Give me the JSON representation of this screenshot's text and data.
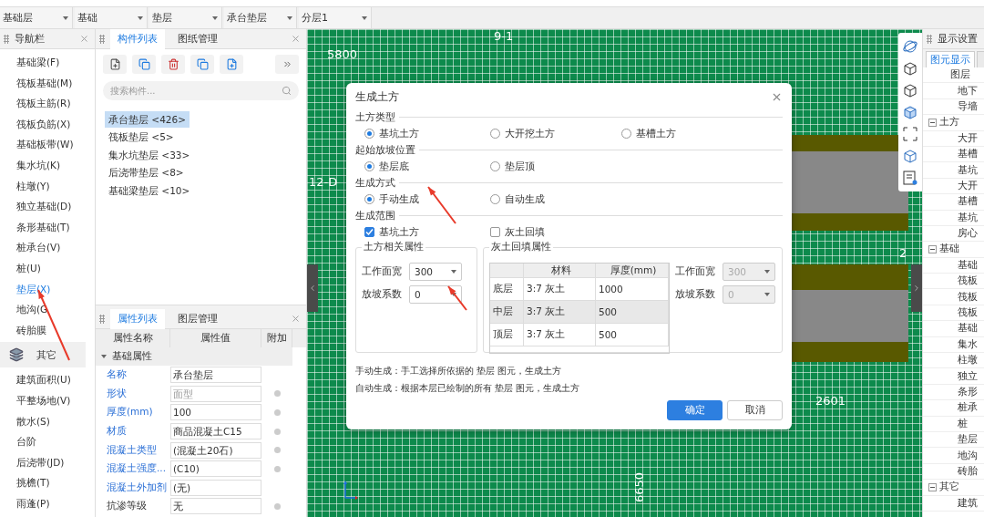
{
  "level_bar": [
    {
      "label": "基础层"
    },
    {
      "label": "基础"
    },
    {
      "label": "垫层"
    },
    {
      "label": "承台垫层"
    },
    {
      "label": "分层1"
    }
  ],
  "nav": {
    "title": "导航栏",
    "items": [
      {
        "label": "基础梁(F)",
        "selected": false
      },
      {
        "label": "筏板基础(M)",
        "selected": false
      },
      {
        "label": "筏板主筋(R)",
        "selected": false
      },
      {
        "label": "筏板负筋(X)",
        "selected": false
      },
      {
        "label": "基础板带(W)",
        "selected": false
      },
      {
        "label": "集水坑(K)",
        "selected": false
      },
      {
        "label": "柱墩(Y)",
        "selected": false
      },
      {
        "label": "独立基础(D)",
        "selected": false
      },
      {
        "label": "条形基础(T)",
        "selected": false
      },
      {
        "label": "桩承台(V)",
        "selected": false
      },
      {
        "label": "桩(U)",
        "selected": false
      },
      {
        "label": "垫层(X)",
        "selected": true
      },
      {
        "label": "地沟(G",
        "selected": false
      },
      {
        "label": "砖胎膜",
        "selected": false
      }
    ],
    "other_group": {
      "label": "其它",
      "items": [
        {
          "label": "建筑面积(U)",
          "selected": false
        },
        {
          "label": "平整场地(V)",
          "selected": false
        },
        {
          "label": "散水(S)",
          "selected": false
        },
        {
          "label": "台阶",
          "selected": false
        },
        {
          "label": "后浇带(JD)",
          "selected": false
        },
        {
          "label": "挑檐(T)",
          "selected": false
        },
        {
          "label": "雨蓬(P)",
          "selected": false
        }
      ]
    }
  },
  "components": {
    "tabs": [
      {
        "label": "构件列表",
        "selected": true
      },
      {
        "label": "图纸管理",
        "selected": false
      }
    ],
    "search": {
      "placeholder": "搜索构件..."
    },
    "items": [
      {
        "label": "承台垫层 <426>",
        "selected": true
      },
      {
        "label": "筏板垫层 <5>",
        "selected": false
      },
      {
        "label": "集水坑垫层 <33>",
        "selected": false
      },
      {
        "label": "后浇带垫层 <8>",
        "selected": false
      },
      {
        "label": "基础梁垫层 <10>",
        "selected": false
      }
    ]
  },
  "properties": {
    "tabs": [
      {
        "label": "属性列表",
        "selected": true
      },
      {
        "label": "图层管理",
        "selected": false
      }
    ],
    "columns": [
      "属性名称",
      "属性值",
      "附加"
    ],
    "group": {
      "label": "基础属性",
      "expanded": true
    },
    "rows": [
      {
        "name": "名称",
        "value": "承台垫层",
        "linked": true,
        "disabled": false,
        "extra": false
      },
      {
        "name": "形状",
        "value": "面型",
        "linked": true,
        "disabled": true,
        "extra": true
      },
      {
        "name": "厚度(mm)",
        "value": "100",
        "linked": true,
        "disabled": false,
        "extra": true
      },
      {
        "name": "材质",
        "value": "商品混凝土C15",
        "linked": true,
        "disabled": false,
        "extra": true
      },
      {
        "name": "混凝土类型",
        "value": "(混凝土20石)",
        "linked": true,
        "disabled": false,
        "extra": true
      },
      {
        "name": "混凝土强度...",
        "value": "(C10)",
        "linked": true,
        "disabled": false,
        "extra": true
      },
      {
        "name": "混凝土外加剂",
        "value": "(无)",
        "linked": true,
        "disabled": false,
        "extra": false
      },
      {
        "name": "抗渗等级",
        "value": "无",
        "linked": false,
        "disabled": false,
        "extra": true
      }
    ]
  },
  "canvas": {
    "labels": [
      {
        "text": "5800"
      },
      {
        "text": "9-1"
      },
      {
        "text": "12-D"
      },
      {
        "text": "2"
      },
      {
        "text": "2601"
      },
      {
        "text": "6650"
      }
    ]
  },
  "dialog": {
    "title": "生成土方",
    "sections": [
      {
        "title": "土方类型",
        "kind": "radio",
        "options": [
          {
            "label": "基坑土方",
            "selected": true
          },
          {
            "label": "大开挖土方",
            "selected": false
          },
          {
            "label": "基槽土方",
            "selected": false
          }
        ]
      },
      {
        "title": "起始放坡位置",
        "kind": "radio",
        "options": [
          {
            "label": "垫层底",
            "selected": true
          },
          {
            "label": "垫层顶",
            "selected": false
          }
        ]
      },
      {
        "title": "生成方式",
        "kind": "radio",
        "options": [
          {
            "label": "手动生成",
            "selected": true
          },
          {
            "label": "自动生成",
            "selected": false
          }
        ]
      },
      {
        "title": "生成范围",
        "kind": "checkbox",
        "options": [
          {
            "label": "基坑土方",
            "checked": true
          },
          {
            "label": "灰土回填",
            "checked": false
          }
        ]
      }
    ],
    "earthwork": {
      "title": "土方相关属性",
      "fields": [
        {
          "label": "工作面宽",
          "value": "300",
          "disabled": false
        },
        {
          "label": "放坡系数",
          "value": "0",
          "disabled": false
        }
      ]
    },
    "backfill": {
      "title": "灰土回填属性",
      "columns": [
        "材料",
        "厚度(mm)"
      ],
      "rows": [
        {
          "layer": "底层",
          "material": "3:7 灰土",
          "thickness": "1000",
          "selected": false
        },
        {
          "layer": "中层",
          "material": "3:7 灰土",
          "thickness": "500",
          "selected": true
        },
        {
          "layer": "顶层",
          "material": "3:7 灰土",
          "thickness": "500",
          "selected": false
        }
      ],
      "fields": [
        {
          "label": "工作面宽",
          "value": "300",
          "disabled": true
        },
        {
          "label": "放坡系数",
          "value": "0",
          "disabled": true
        }
      ]
    },
    "notes": [
      "手动生成：手工选择所依据的 垫层 图元，生成土方",
      "自动生成：根据本层已绘制的所有 垫层 图元，生成土方"
    ],
    "buttons": [
      {
        "label": "确定",
        "kind": "primary"
      },
      {
        "label": "取消",
        "kind": "secondary"
      }
    ]
  },
  "display": {
    "title": "显示设置",
    "tabs": [
      {
        "label": "图元显示",
        "selected": true
      }
    ],
    "header": "图层",
    "tree": [
      {
        "label": "地下"
      },
      {
        "label": "导墙"
      },
      {
        "label": "土方",
        "expanded": true,
        "children": [
          {
            "label": "大开"
          },
          {
            "label": "基槽"
          },
          {
            "label": "基坑"
          },
          {
            "label": "大开"
          },
          {
            "label": "基槽"
          },
          {
            "label": "基坑"
          },
          {
            "label": "房心"
          }
        ]
      },
      {
        "label": "基础",
        "expanded": true,
        "children": [
          {
            "label": "基础"
          },
          {
            "label": "筏板"
          },
          {
            "label": "筏板"
          },
          {
            "label": "筏板"
          },
          {
            "label": "基础"
          },
          {
            "label": "集水"
          },
          {
            "label": "柱墩"
          },
          {
            "label": "独立"
          },
          {
            "label": "条形"
          },
          {
            "label": "桩承"
          },
          {
            "label": "桩"
          },
          {
            "label": "垫层"
          },
          {
            "label": "地沟"
          },
          {
            "label": "砖胎"
          }
        ]
      },
      {
        "label": "其它",
        "expanded": true,
        "children": [
          {
            "label": "建筑"
          }
        ]
      }
    ]
  }
}
